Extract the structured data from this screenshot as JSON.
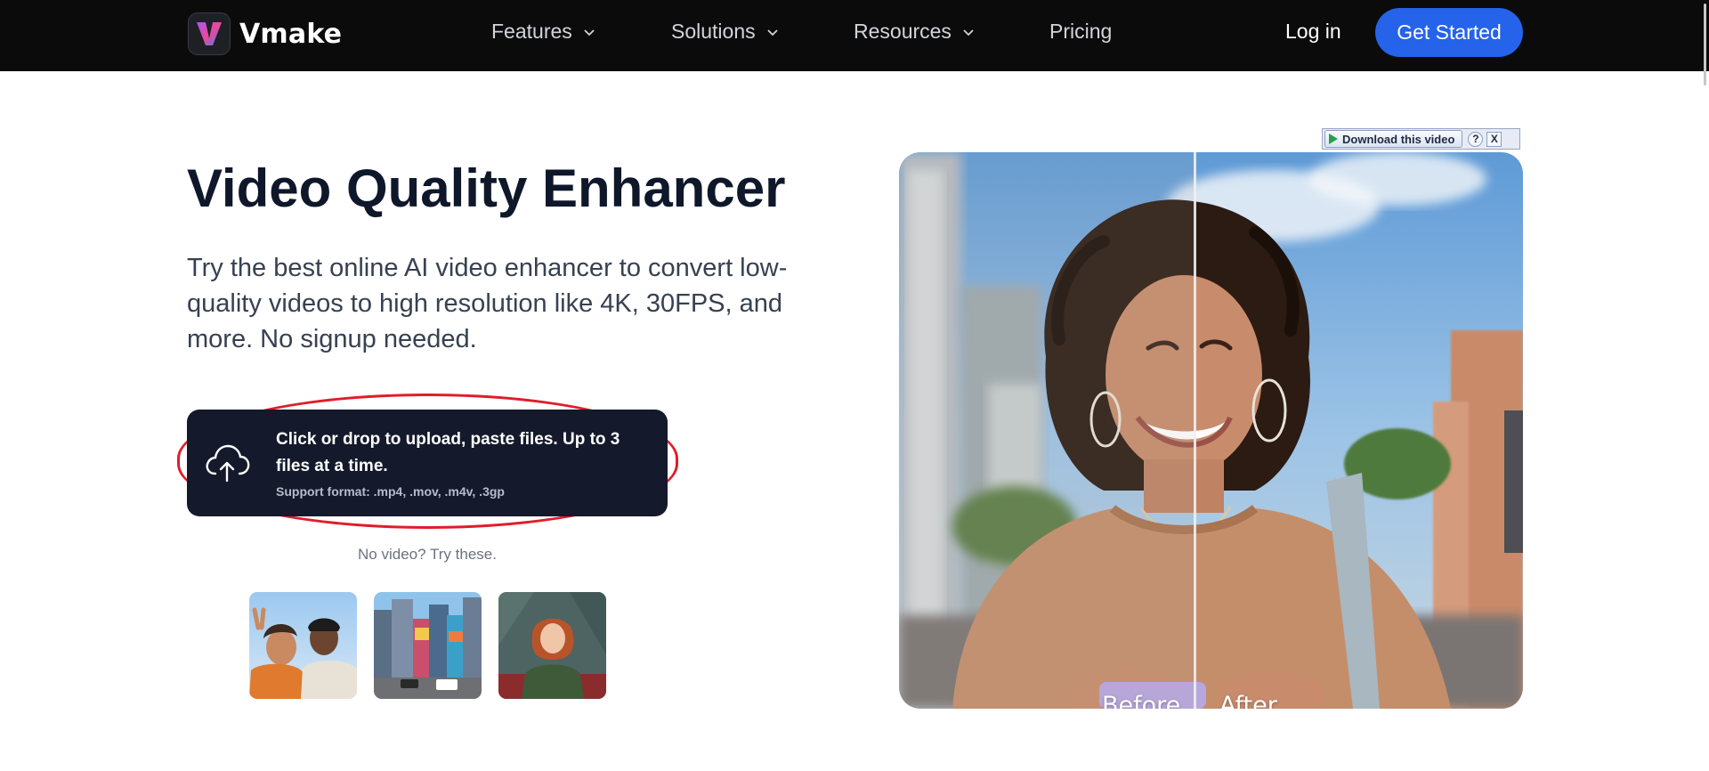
{
  "nav": {
    "logo_text": "Vmake",
    "items": [
      {
        "label": "Features",
        "has_dropdown": true
      },
      {
        "label": "Solutions",
        "has_dropdown": true
      },
      {
        "label": "Resources",
        "has_dropdown": true
      },
      {
        "label": "Pricing",
        "has_dropdown": false
      }
    ],
    "login_label": "Log in",
    "cta_label": "Get Started"
  },
  "hero": {
    "title": "Video Quality Enhancer",
    "subtitle": "Try the best online AI video enhancer to convert low-quality videos to high resolution like 4K, 30FPS, and more. No signup needed.",
    "upload": {
      "main_text": "Click or drop to upload, paste files. Up to 3 files at a time.",
      "formats_text": "Support format: .mp4, .mov, .m4v, .3gp",
      "icon": "cloud-upload-icon"
    },
    "try_text": "No video? Try these.",
    "samples": [
      "sample-friends-selfie",
      "sample-city-street",
      "sample-woman-portrait"
    ]
  },
  "preview": {
    "before_label": "Before",
    "after_label": "After"
  },
  "download_bar": {
    "label": "Download this video",
    "help": "?",
    "close": "X"
  },
  "colors": {
    "nav_bg": "#0b0b0b",
    "accent": "#2563eb",
    "upload_bg": "#141a2b",
    "highlight_ring": "#e11d2a"
  }
}
